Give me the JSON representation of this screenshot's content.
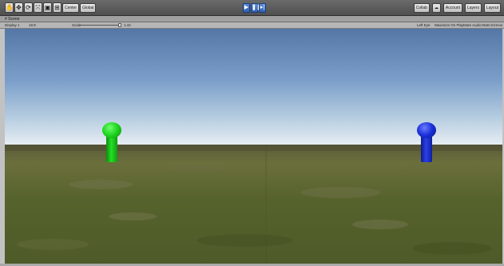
{
  "toolbar": {
    "tool_icons": [
      "hand-icon",
      "move-icon",
      "rotate-icon",
      "scale-icon",
      "rect-tool-icon",
      "transform-tool-icon"
    ],
    "pivot_label": "Center",
    "space_label": "Global",
    "play_icons": [
      "play-icon",
      "pause-icon",
      "step-icon"
    ],
    "collab_label": "Collab",
    "account_label": "Account",
    "layers_label": "Layers",
    "layout_label": "Layout"
  },
  "tabs": {
    "scene": "Scene"
  },
  "scenebar": {
    "display": "Display 1",
    "aspect": "16:9",
    "scale_label": "Scale",
    "scale_value": "1.44",
    "maximize": "Maximize On Play",
    "mute": "Mute Audio",
    "stats": "Stats",
    "gizmos": "Gizmos",
    "left_eye": "Left Eye"
  },
  "scene": {
    "sky_color": "#7c9fca",
    "ground_color": "#57632d",
    "characters": [
      {
        "name": "green",
        "color": "#1fd41f"
      },
      {
        "name": "blue",
        "color": "#1a2fd6"
      }
    ]
  }
}
